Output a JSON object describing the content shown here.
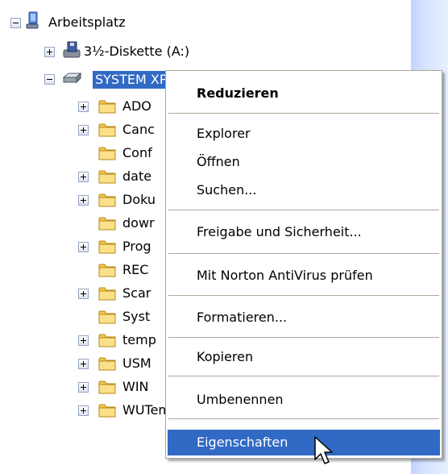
{
  "tree": {
    "root": {
      "label": "Arbeitsplatz",
      "icon": "my-computer-icon"
    },
    "floppy": {
      "label": "3½-Diskette (A:)",
      "icon": "floppy-drive-icon"
    },
    "drive": {
      "label": "SYSTEM XP (C:)",
      "icon": "hard-drive-icon"
    },
    "folders": [
      {
        "label": "ADO",
        "expandable": true
      },
      {
        "label": "Canc",
        "expandable": true
      },
      {
        "label": "Conf",
        "expandable": false
      },
      {
        "label": "date",
        "expandable": true
      },
      {
        "label": "Doku",
        "expandable": true
      },
      {
        "label": "dowr",
        "expandable": false
      },
      {
        "label": "Prog",
        "expandable": true
      },
      {
        "label": "REC",
        "expandable": false
      },
      {
        "label": "Scar",
        "expandable": true
      },
      {
        "label": "Syst",
        "expandable": false
      },
      {
        "label": "temp",
        "expandable": true
      },
      {
        "label": "USM",
        "expandable": true
      },
      {
        "label": "WIN",
        "expandable": true
      },
      {
        "label": "WUTemp",
        "expandable": true
      }
    ]
  },
  "context_menu": {
    "items": [
      {
        "label": "Reduzieren",
        "bold": true
      },
      {
        "label": "Explorer"
      },
      {
        "label": "Öffnen"
      },
      {
        "label": "Suchen..."
      },
      {
        "label": "Freigabe und Sicherheit..."
      },
      {
        "label": "Mit Norton AntiVirus prüfen"
      },
      {
        "label": "Formatieren..."
      },
      {
        "label": "Kopieren"
      },
      {
        "label": "Umbenennen"
      },
      {
        "label": "Eigenschaften",
        "highlighted": true
      }
    ]
  },
  "colors": {
    "selection": "#316ac5",
    "folder": "#f3c74c",
    "menu_border": "#aca899",
    "scrollbar": "#d7e3fe"
  }
}
